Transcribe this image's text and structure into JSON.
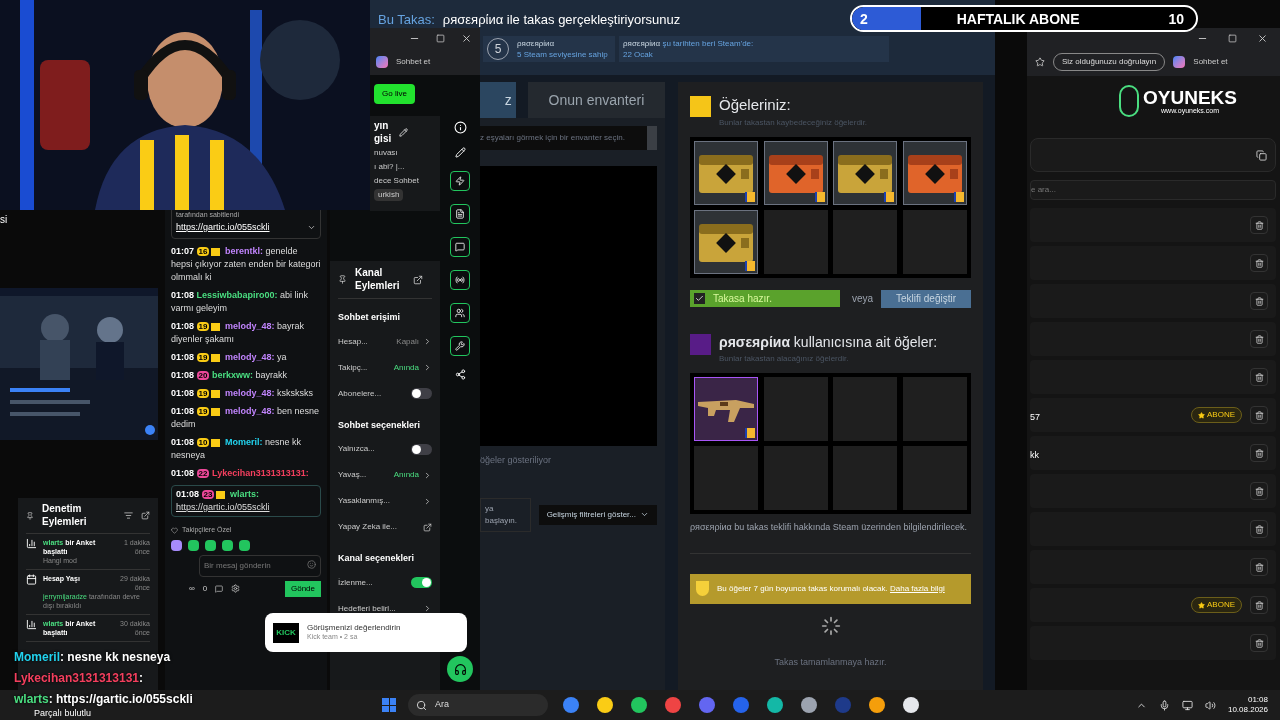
{
  "left_fragment": "si",
  "sub_goal": {
    "current": "2",
    "label": "HAFTALIK ABONE",
    "target": "10",
    "level": 0.2
  },
  "trade_header": {
    "prefix": "Bu Takas:",
    "text": "ρяσεяρίиα ile takas gerçekleştiriyorsunuz"
  },
  "partner_info": {
    "level": "5",
    "name": "ρяσεяρίиα",
    "level_text": "5 Steam seviyesine sahip",
    "since_name": "ρяσεяρίиα",
    "since_text": "şu tarihten beri Steam'de:",
    "since_date": "22 Ocak"
  },
  "steam_tabs": [
    {
      "label": "z",
      "selected": true
    },
    {
      "label": "Onun envanteri",
      "selected": false
    }
  ],
  "inventory": {
    "select_text": "z eşyaları görmek için bir envanter seçin.",
    "showing": "öğeler gösteriliyor",
    "search_hint": "ya başlayın.",
    "filters": "Gelişmiş filtreleri göster..."
  },
  "your_items": {
    "title": "Öğeleriniz:",
    "subtitle": "Bunlar takastan kaybedeceğiniz öğelerdir.",
    "slots": [
      {
        "kind": "gold"
      },
      {
        "kind": "orange"
      },
      {
        "kind": "gold"
      },
      {
        "kind": "orange"
      },
      {
        "kind": "gold"
      },
      {
        "kind": "empty"
      },
      {
        "kind": "empty"
      },
      {
        "kind": "empty"
      }
    ]
  },
  "ready": {
    "label": "Takasa hazır.",
    "checked": true,
    "or": "veya",
    "change": "Teklifi değiştir"
  },
  "their_items": {
    "name": "ρяσεяρίиα",
    "title": " kullanıcısına ait öğeler:",
    "subtitle": "Bunlar takastan alacağınız öğelerdir.",
    "slots": [
      {
        "kind": "rifle"
      },
      {
        "kind": "empty"
      },
      {
        "kind": "empty"
      },
      {
        "kind": "empty"
      },
      {
        "kind": "empty"
      },
      {
        "kind": "empty"
      },
      {
        "kind": "empty"
      },
      {
        "kind": "empty"
      }
    ]
  },
  "notice": "ρяσεяρίиα bu takas teklifi hakkında Steam üzerinden bilgilendirilecek.",
  "protection": {
    "text": "Bu öğeler 7 gün boyunca takas korumalı olacak.",
    "link": "Daha fazla bilgi"
  },
  "trade_status": "Takas tamamlanmaya hazır.",
  "popup": {
    "tab": "Sohbet et",
    "go_live": "Go live",
    "info_title": [
      "yın",
      "gisi"
    ],
    "info_lines": [
      "nuvası",
      "ı abi? |...",
      "dece Sohbet"
    ],
    "language": "urkish"
  },
  "channel_actions": {
    "title": "Kanal Eylemleri",
    "items": [
      {
        "kind": "header",
        "label": "Sohbet erişimi"
      },
      {
        "kind": "value",
        "label": "Hesap...",
        "value": "Kapalı",
        "active": false
      },
      {
        "kind": "value",
        "label": "Takipç...",
        "value": "Anında",
        "active": true
      },
      {
        "kind": "toggle",
        "label": "Abonelere...",
        "on": false
      },
      {
        "kind": "header",
        "label": "Sohbet seçenekleri"
      },
      {
        "kind": "toggle",
        "label": "Yalnızca...",
        "on": false
      },
      {
        "kind": "value",
        "label": "Yavaş...",
        "value": "Anında",
        "active": true
      },
      {
        "kind": "link",
        "label": "Yasaklanmış..."
      },
      {
        "kind": "external",
        "label": "Yapay Zeka ile..."
      },
      {
        "kind": "header",
        "label": "Kanal seçenekleri"
      },
      {
        "kind": "toggle",
        "label": "İzlenme...",
        "on": true
      },
      {
        "kind": "link",
        "label": "Hedefleri belirl..."
      }
    ]
  },
  "toast": {
    "logo": "KICK",
    "title": "Görüşmenizi değerlendirin",
    "meta": "Kick team • 2 sa"
  },
  "chat": {
    "pinned_by": "tarafından sabitlendi",
    "pinned_link": "https://gartic.io/055sckli",
    "messages": [
      {
        "time": "01:07",
        "badge": {
          "label": "16",
          "color": "#facc15"
        },
        "crown": true,
        "user": "berentkl",
        "color": "#c084fc",
        "separator": ":",
        "text": "genelde hepsi çıkıyor zaten enden bir kategori olmmalı ki",
        "highlight": false
      },
      {
        "time": "01:08",
        "user": "Lessiwbabapiro00",
        "color": "#4ade80",
        "separator": ":",
        "text": "abi link varmı geleyim",
        "crown": false,
        "highlight": false
      },
      {
        "time": "01:08",
        "badge": {
          "label": "19",
          "color": "#facc15"
        },
        "crown": true,
        "user": "melody_48",
        "color": "#c084fc",
        "separator": ":",
        "text": "bayrak diyenler şakamı",
        "highlight": false
      },
      {
        "time": "01:08",
        "badge": {
          "label": "19",
          "color": "#facc15"
        },
        "crown": true,
        "user": "melody_48",
        "color": "#c084fc",
        "separator": ":",
        "text": "ya",
        "highlight": false
      },
      {
        "time": "01:08",
        "badge": {
          "label": "20",
          "color": "#ec4899"
        },
        "crown": false,
        "user": "berkxww",
        "color": "#4ade80",
        "separator": ":",
        "text": "bayrakk",
        "highlight": false
      },
      {
        "time": "01:08",
        "badge": {
          "label": "19",
          "color": "#facc15"
        },
        "crown": true,
        "user": "melody_48",
        "color": "#c084fc",
        "separator": ":",
        "text": "ksksksks",
        "highlight": false
      },
      {
        "time": "01:08",
        "badge": {
          "label": "19",
          "color": "#facc15"
        },
        "crown": true,
        "user": "melody_48",
        "color": "#c084fc",
        "separator": ":",
        "text": "ben nesne dedim",
        "highlight": false
      },
      {
        "time": "01:08",
        "badge": {
          "label": "10",
          "color": "#facc15"
        },
        "crown": true,
        "user": "Momeril",
        "color": "#22d3ee",
        "separator": ":",
        "text": "nesne kk nesneya",
        "highlight": false
      },
      {
        "time": "01:08",
        "badge": {
          "label": "22",
          "color": "#ec4899"
        },
        "crown": false,
        "user": "Lykecihan3131313131",
        "color": "#f43f5e",
        "separator": ":",
        "highlight": false
      },
      {
        "time": "01:08",
        "badge": {
          "label": "23",
          "color": "#ec4899"
        },
        "crown": true,
        "user": "wlarts",
        "color": "#4ade80",
        "separator": ":",
        "text": "https://gartic.io/055sckli",
        "highlight": true
      }
    ],
    "followers_only": "Takipçilere Özel",
    "placeholder": "Bir mesaj gönderin",
    "infinity": "∞",
    "points": "0",
    "send": "Gönde"
  },
  "mod_actions": {
    "title": "Denetim Eylemleri",
    "entries": [
      {
        "kind": "poll",
        "user": "wlarts",
        "text": "bir Anket başlattı",
        "time": "1 dakika önce",
        "detail": "Hangi mod"
      },
      {
        "kind": "account",
        "title": "Hesap Yaşı",
        "time": "29 dakika önce",
        "user": "jerrymijaradze",
        "text": "tarafından devre dışı bırakıldı"
      },
      {
        "kind": "poll",
        "user": "wlarts",
        "text": "bir Anket başlattı",
        "time": "30 dakika önce"
      }
    ]
  },
  "overlay_chat": [
    {
      "user": "Momeril",
      "color": "#22d3ee",
      "text": ": nesne kk nesneya"
    },
    {
      "user": "Lykecihan3131313131",
      "color": "#f43f5e",
      "text": ":"
    },
    {
      "user": "wlarts",
      "color": "#4ade80",
      "text": ": https://gartic.io/055sckli"
    }
  ],
  "weather": "Parçalı bulutlu",
  "site": {
    "verify": "Siz olduğunuzu doğrulayın",
    "chat": "Sohbet et",
    "logo": "OYUNEKS",
    "url": "www.oyuneks.com",
    "search_placeholder": "e ara...",
    "rows": [
      {},
      {},
      {},
      {},
      {},
      {
        "text": "57",
        "badge": "ABONE"
      },
      {
        "text": "kk"
      },
      {},
      {},
      {},
      {
        "badge": "ABONE"
      },
      {}
    ]
  },
  "taskbar": {
    "search": "Ara",
    "time": "01:08",
    "date": "10.08.2026"
  }
}
